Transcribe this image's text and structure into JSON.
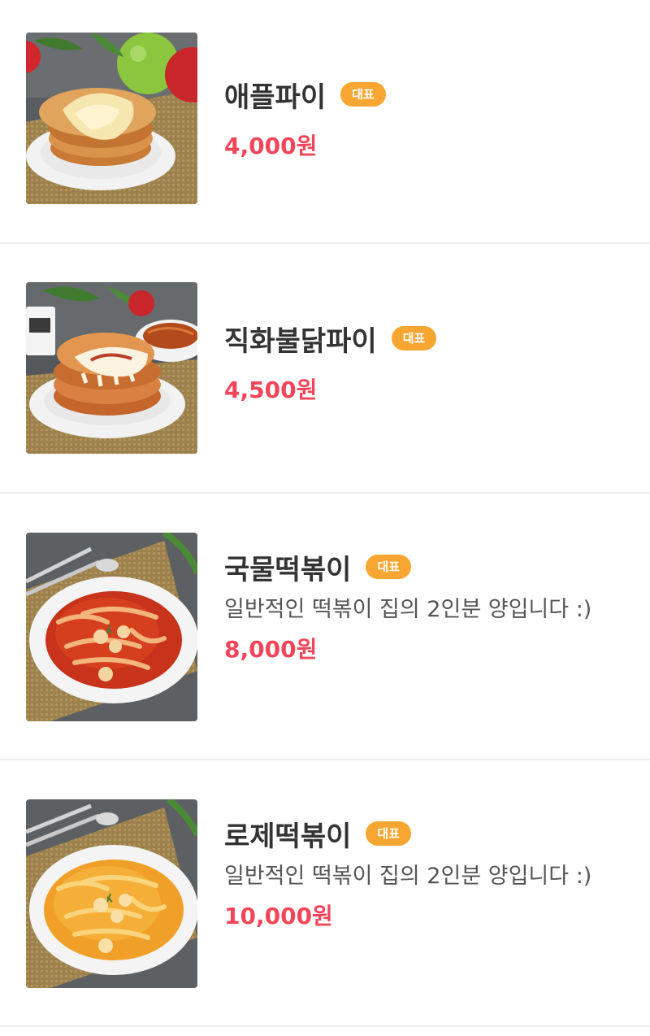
{
  "theme": {
    "badge_color": "#f7a631",
    "price_color": "#f2455a"
  },
  "menu": {
    "items": [
      {
        "name": "애플파이",
        "badge": "대표",
        "description": "",
        "price": "4,000원",
        "image": "apple-pie-photo"
      },
      {
        "name": "직화불닭파이",
        "badge": "대표",
        "description": "",
        "price": "4,500원",
        "image": "fire-chicken-pie-photo"
      },
      {
        "name": "국물떡볶이",
        "badge": "대표",
        "description": "일반적인 떡볶이 집의 2인분 양입니다 :)",
        "price": "8,000원",
        "image": "soup-tteokbokki-photo"
      },
      {
        "name": "로제떡볶이",
        "badge": "대표",
        "description": "일반적인 떡볶이 집의 2인분 양입니다 :)",
        "price": "10,000원",
        "image": "rose-tteokbokki-photo"
      }
    ]
  }
}
